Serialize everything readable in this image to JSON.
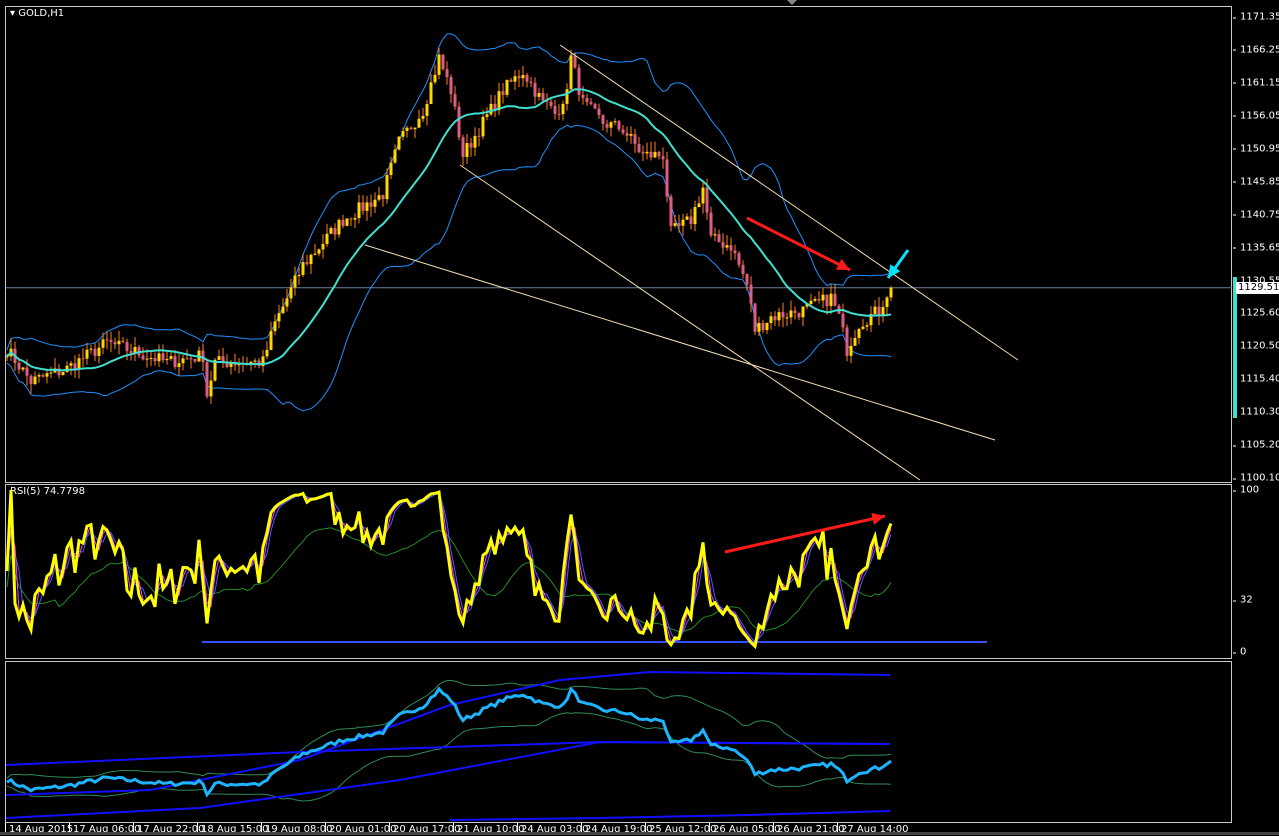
{
  "main": {
    "title": "GOLD,H1",
    "current_price": "1129.51",
    "price_ticks": [
      "1171.35",
      "1166.25",
      "1161.15",
      "1156.05",
      "1150.95",
      "1145.85",
      "1140.75",
      "1135.65",
      "1130.55",
      "1125.60",
      "1120.50",
      "1115.40",
      "1110.30",
      "1105.20",
      "1100.10"
    ],
    "price_range": [
      1100.1,
      1171.35
    ],
    "price_path_anchors": [
      [
        0,
        1120
      ],
      [
        6,
        1115
      ],
      [
        15,
        1117
      ],
      [
        25,
        1121
      ],
      [
        40,
        1118
      ],
      [
        49,
        1119
      ],
      [
        50,
        1113
      ],
      [
        52,
        1118
      ],
      [
        64,
        1118
      ],
      [
        67,
        1124
      ],
      [
        74,
        1133
      ],
      [
        84,
        1140
      ],
      [
        94,
        1144
      ],
      [
        98,
        1152
      ],
      [
        104,
        1157
      ],
      [
        108,
        1165
      ],
      [
        111,
        1160
      ],
      [
        114,
        1150
      ],
      [
        119,
        1155
      ],
      [
        124,
        1160
      ],
      [
        129,
        1163
      ],
      [
        134,
        1158
      ],
      [
        139,
        1157
      ],
      [
        141,
        1165
      ],
      [
        144,
        1158
      ],
      [
        149,
        1155
      ],
      [
        154,
        1154
      ],
      [
        159,
        1150
      ],
      [
        164,
        1150
      ],
      [
        166,
        1138
      ],
      [
        171,
        1140
      ],
      [
        174,
        1145
      ],
      [
        176,
        1137
      ],
      [
        181,
        1136
      ],
      [
        185,
        1130
      ],
      [
        187,
        1123
      ],
      [
        191,
        1125
      ],
      [
        199,
        1126
      ],
      [
        206,
        1128
      ],
      [
        208,
        1125
      ],
      [
        210,
        1120
      ],
      [
        213,
        1124
      ],
      [
        218,
        1126
      ],
      [
        221,
        1130
      ]
    ],
    "colors": {
      "bull": "#ffd700",
      "bear": "#e05a8a",
      "wick": "#ff7f1f",
      "ma": "#40e0d0",
      "bands": "#1e90ff",
      "trendline": "#f5deb3",
      "arrow_red": "#ff1a1a",
      "arrow_cyan": "#00e5ff"
    }
  },
  "rsi": {
    "title": "RSI(5) 74.7798",
    "period": 5,
    "ticks": [
      "100",
      "32",
      "0"
    ],
    "colors": {
      "rsi": "#ffff00",
      "fast": "#ff40ff",
      "slow": "#4060ff",
      "signal": "#228b22",
      "level": "#3050ff"
    }
  },
  "time_axis": [
    "14 Aug 2015",
    "17 Aug 06:00",
    "17 Aug 22:00",
    "18 Aug 15:00",
    "19 Aug 08:00",
    "20 Aug 01:00",
    "20 Aug 17:00",
    "21 Aug 10:00",
    "24 Aug 03:00",
    "24 Aug 19:00",
    "25 Aug 12:00",
    "26 Aug 05:00",
    "26 Aug 21:00",
    "27 Aug 14:00"
  ]
}
